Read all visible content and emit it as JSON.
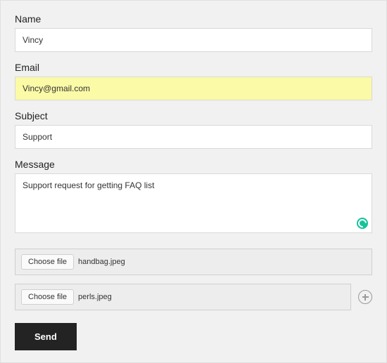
{
  "fields": {
    "name": {
      "label": "Name",
      "value": "Vincy"
    },
    "email": {
      "label": "Email",
      "value": "Vincy@gmail.com"
    },
    "subject": {
      "label": "Subject",
      "value": "Support"
    },
    "message": {
      "label": "Message",
      "value": "Support request for getting FAQ list"
    }
  },
  "files": {
    "choose_button_label": "Choose file",
    "rows": [
      {
        "filename": "handbag.jpeg"
      },
      {
        "filename": "perls.jpeg"
      }
    ]
  },
  "buttons": {
    "send": "Send"
  }
}
